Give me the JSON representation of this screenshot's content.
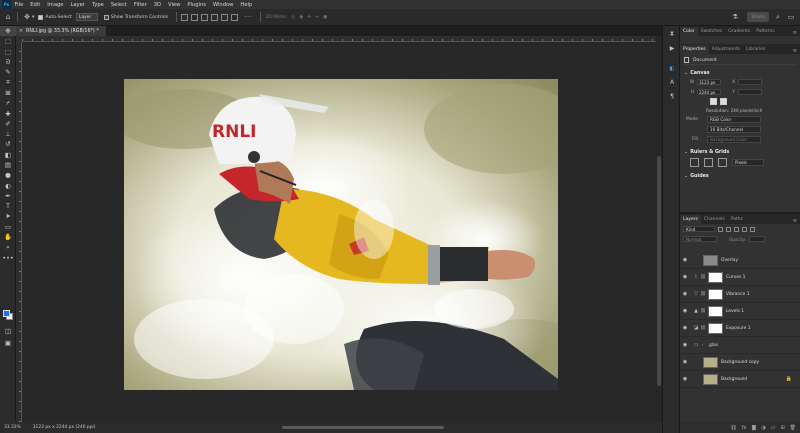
{
  "app": {
    "logo": "Ps"
  },
  "menu": [
    "File",
    "Edit",
    "Image",
    "Layer",
    "Type",
    "Select",
    "Filter",
    "3D",
    "View",
    "Plugins",
    "Window",
    "Help"
  ],
  "options_bar": {
    "auto_select_label": "Auto-Select",
    "auto_select_target": "Layer",
    "transform_controls_label": "Show Transform Controls",
    "mode_3d_label": "3D Mode:",
    "share_label": "Share"
  },
  "document": {
    "tab_title": "RNLI.jpg @ 33.3% (RGB/16*) *",
    "close_glyph": "×",
    "zoom_status": "33.33%",
    "size_status": "3123 px x 2244 px (240 ppi)"
  },
  "tools": [
    "move-tool",
    "artboard-tool",
    "marquee-tool",
    "lasso-tool",
    "quick-select-tool",
    "crop-tool",
    "frame-tool",
    "eyedropper-tool",
    "healing-tool",
    "brush-tool",
    "clone-stamp-tool",
    "history-brush-tool",
    "eraser-tool",
    "gradient-tool",
    "blur-tool",
    "dodge-tool",
    "pen-tool",
    "type-tool",
    "path-select-tool",
    "rectangle-tool",
    "hand-tool",
    "zoom-tool",
    "more-tools"
  ],
  "colors": {
    "foreground": "#1f6fff",
    "background": "#ffffff",
    "accent": "#31a8ff"
  },
  "color_panel": {
    "tabs": [
      "Color",
      "Swatches",
      "Gradients",
      "Patterns"
    ]
  },
  "properties_panel": {
    "tabs": [
      "Properties",
      "Adjustments",
      "Libraries"
    ],
    "document_label": "Document",
    "canvas_heading": "Canvas",
    "width_label": "W",
    "width_value": "3123 px",
    "height_label": "H",
    "height_value": "2244 px",
    "x_label": "X",
    "y_label": "Y",
    "resolution": "Resolution: 240 pixels/inch",
    "mode_label": "Mode",
    "mode_value": "RGB Color",
    "depth_value": "16 Bits/Channel",
    "fill_label": "Fill",
    "fill_value": "Background Color",
    "rulers_heading": "Rulers & Grids",
    "units_value": "Pixels",
    "guides_heading": "Guides"
  },
  "layers_panel": {
    "tabs": [
      "Layers",
      "Channels",
      "Paths"
    ],
    "kind_label": "Kind",
    "blend_mode": "Normal",
    "opacity_label": "Opacity:",
    "layers": [
      {
        "name": "Overlay",
        "thumb_color": "#8a8a8a",
        "adj_icon": ""
      },
      {
        "name": "Curves 1",
        "thumb_color": "#ffffff",
        "adj_icon": "⌇"
      },
      {
        "name": "Vibrance 1",
        "thumb_color": "#ffffff",
        "adj_icon": "▽"
      },
      {
        "name": "Levels 1",
        "thumb_color": "#ffffff",
        "adj_icon": "▲"
      },
      {
        "name": "Exposure 1",
        "thumb_color": "#ffffff",
        "adj_icon": "◪"
      },
      {
        "name": "glas",
        "thumb_color": "",
        "adj_icon": "▭"
      },
      {
        "name": "Background copy",
        "thumb_color": "#b5b08a",
        "adj_icon": ""
      },
      {
        "name": "Background",
        "thumb_color": "#b5b08a",
        "adj_icon": ""
      }
    ]
  },
  "image_text": {
    "helmet_text": "RNLI"
  }
}
